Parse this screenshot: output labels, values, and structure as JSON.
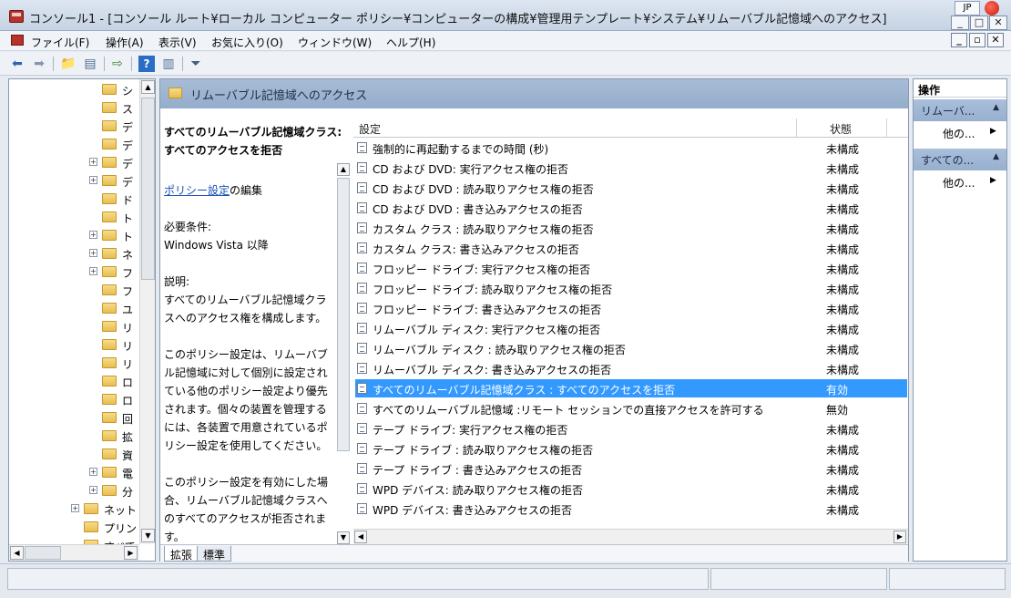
{
  "window": {
    "title": "コンソール1 - [コンソール ルート¥ローカル コンピューター ポリシー¥コンピューターの構成¥管理用テンプレート¥システム¥リムーバブル記憶域へのアクセス]",
    "ime_label": "JP"
  },
  "menu": {
    "items": [
      "ファイル(F)",
      "操作(A)",
      "表示(V)",
      "お気に入り(O)",
      "ウィンドウ(W)",
      "ヘルプ(H)"
    ]
  },
  "tree": {
    "items": [
      {
        "label": "シ",
        "expand": ""
      },
      {
        "label": "ス",
        "expand": ""
      },
      {
        "label": "デ",
        "expand": ""
      },
      {
        "label": "デ",
        "expand": ""
      },
      {
        "label": "デ",
        "expand": "+"
      },
      {
        "label": "デ",
        "expand": "+"
      },
      {
        "label": "ド",
        "expand": ""
      },
      {
        "label": "ト",
        "expand": ""
      },
      {
        "label": "ト",
        "expand": "+"
      },
      {
        "label": "ネ",
        "expand": "+"
      },
      {
        "label": "フ",
        "expand": "+"
      },
      {
        "label": "フ",
        "expand": ""
      },
      {
        "label": "ユ",
        "expand": ""
      },
      {
        "label": "リ",
        "expand": ""
      },
      {
        "label": "リ",
        "expand": ""
      },
      {
        "label": "リ",
        "expand": ""
      },
      {
        "label": "ロ",
        "expand": ""
      },
      {
        "label": "ロ",
        "expand": ""
      },
      {
        "label": "回",
        "expand": ""
      },
      {
        "label": "拡",
        "expand": ""
      },
      {
        "label": "資",
        "expand": ""
      },
      {
        "label": "電",
        "expand": "+"
      },
      {
        "label": "分",
        "expand": "+"
      },
      {
        "label": "ネット",
        "expand": "+"
      },
      {
        "label": "プリン",
        "expand": ""
      },
      {
        "label": "すべて",
        "expand": ""
      }
    ]
  },
  "center": {
    "header": "リムーバブル記憶域へのアクセス",
    "desc_title_1": "すべてのリムーバブル記憶域クラス:",
    "desc_title_2": "すべてのアクセスを拒否",
    "desc_edit_link": "ポリシー設定",
    "desc_edit_suffix": "の編集",
    "req_label": "必要条件:",
    "req_value": "Windows Vista 以降",
    "explain_label": "説明:",
    "explain_p1_1": "すべてのリムーバブル記憶域クラ",
    "explain_p1_2": "スへのアクセス権を構成します。",
    "explain_p2_1": "このポリシー設定は、リムーバブ",
    "explain_p2_2": "ル記憶域に対して個別に設定され",
    "explain_p2_3": "ている他のポリシー設定より優先",
    "explain_p2_4": "されます。個々の装置を管理する",
    "explain_p2_5": "には、各装置で用意されているポ",
    "explain_p2_6": "リシー設定を使用してください。",
    "explain_p3_1": "このポリシー設定を有効にした場",
    "explain_p3_2": "合、リムーバブル記憶域クラスへ",
    "explain_p3_3": "のすべてのアクセスが拒否されま",
    "explain_p3_4": "す。",
    "col_setting": "設定",
    "col_state": "状態",
    "rows": [
      {
        "name": "強制的に再起動するまでの時間 (秒)",
        "state": "未構成"
      },
      {
        "name": "CD および DVD: 実行アクセス権の拒否",
        "state": "未構成"
      },
      {
        "name": "CD および DVD : 読み取りアクセス権の拒否",
        "state": "未構成"
      },
      {
        "name": "CD および DVD : 書き込みアクセスの拒否",
        "state": "未構成"
      },
      {
        "name": "カスタム クラス : 読み取りアクセス権の拒否",
        "state": "未構成"
      },
      {
        "name": "カスタム クラス: 書き込みアクセスの拒否",
        "state": "未構成"
      },
      {
        "name": "フロッピー ドライブ: 実行アクセス権の拒否",
        "state": "未構成"
      },
      {
        "name": "フロッピー ドライブ: 読み取りアクセス権の拒否",
        "state": "未構成"
      },
      {
        "name": "フロッピー ドライブ: 書き込みアクセスの拒否",
        "state": "未構成"
      },
      {
        "name": "リムーバブル ディスク: 実行アクセス権の拒否",
        "state": "未構成"
      },
      {
        "name": "リムーバブル ディスク : 読み取りアクセス権の拒否",
        "state": "未構成"
      },
      {
        "name": "リムーバブル ディスク: 書き込みアクセスの拒否",
        "state": "未構成"
      },
      {
        "name": "すべてのリムーバブル記憶域クラス : すべてのアクセスを拒否",
        "state": "有効"
      },
      {
        "name": "すべてのリムーバブル記憶域 :リモート セッションでの直接アクセスを許可する",
        "state": "無効"
      },
      {
        "name": "テープ ドライブ: 実行アクセス権の拒否",
        "state": "未構成"
      },
      {
        "name": "テープ ドライブ : 読み取りアクセス権の拒否",
        "state": "未構成"
      },
      {
        "name": "テープ ドライブ : 書き込みアクセスの拒否",
        "state": "未構成"
      },
      {
        "name": "WPD デバイス: 読み取りアクセス権の拒否",
        "state": "未構成"
      },
      {
        "name": "WPD デバイス: 書き込みアクセスの拒否",
        "state": "未構成"
      }
    ],
    "selected_row": 12,
    "tab_extended": "拡張",
    "tab_standard": "標準"
  },
  "actions": {
    "header": "操作",
    "group1": "リムーバ...",
    "group1_item": "他の...",
    "group2": "すべての...",
    "group2_item": "他の..."
  },
  "colors": {
    "selection": "#3399ff",
    "header_band": "#a7bcd6"
  }
}
